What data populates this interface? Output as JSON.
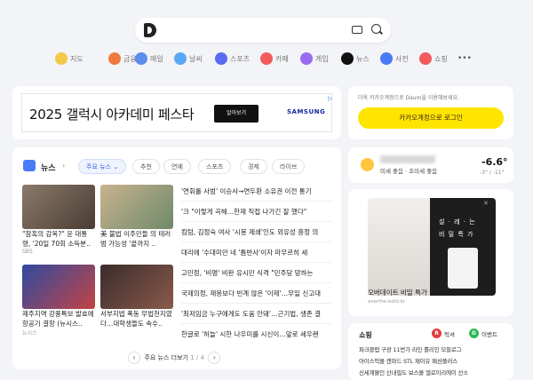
{
  "search": {
    "logo": "D"
  },
  "services": [
    {
      "label": "지도",
      "color": "#f3c948"
    },
    {
      "label": "금융",
      "color": "#f07a3e"
    },
    {
      "label": "메일",
      "color": "#5b8def"
    },
    {
      "label": "날씨",
      "color": "#5aa7f2"
    },
    {
      "label": "스포츠",
      "color": "#5a6cf0"
    },
    {
      "label": "카페",
      "color": "#f25c5c"
    },
    {
      "label": "게임",
      "color": "#9a6bf2"
    },
    {
      "label": "쇼핑",
      "color": "#f25c5c"
    }
  ],
  "more_label": "•••",
  "ad_banner": {
    "text": "2025 갤럭시 아카데미 페스타",
    "button": "알아보기",
    "brand": "SAMSUNG",
    "ad_mark": "▷"
  },
  "news": {
    "title": "뉴스",
    "tabs": [
      "주요 뉴스",
      "추천",
      "연예",
      "스포츠",
      "경제",
      "라이브"
    ],
    "cards": [
      {
        "caption": "\"참혹의 감옥?\" 윤 대통령, '20일 70회 소득분..",
        "source": "SBS",
        "color": "#7a6657"
      },
      {
        "caption": "美 불법 이주민들 의 테러범 가능성 '끝까지 ..",
        "source": "",
        "color": "#b39a78"
      },
      {
        "caption": "제주지역 강풍특보 발효에 항공기 결항 (뉴시스..",
        "source": "뉴시스",
        "color": "#2d3d7a"
      },
      {
        "caption": "서부지법 폭동 무법천지였다…대학생들도 속수..",
        "source": "",
        "color": "#5a4040"
      }
    ],
    "headlines": [
      "'연휘롤 사범' 이승사→연두환 소유권 이전 통기",
      "'크 \"이렇게 곡해…한재 직접 나가긴 잘 했다\"",
      "킴텀, 김정숙 여사 '시봉 제쇄'인도 외유성 흥정 의",
      "대리에 '수대미만 네 '틈반사'이자 마무르히 세",
      "고민정, '비명' 비판 유시민 식격 \"민주당 망하는",
      "국제의정, 재몽보다 빈계 않은 '이제'…무일 신고대",
      "'최저임금 누구에게도 도움 안돼'…근기법, 생존 결",
      "한글로 '허늘' 시한 나우미를 시신이…앞로 세우랜"
    ],
    "pager_label": "주요 뉴스 더보기",
    "pager_page": "1 / 4"
  },
  "login": {
    "notice": "더욱 카카오계정으로 Daum을 이용해보세요.",
    "button": "카카오계정으로 로그인"
  },
  "weather": {
    "sub": "미세 좋음 · 초미세 좋음",
    "temp": "-6.6°",
    "range": "-3° / -11°"
  },
  "ad_box": {
    "line1": "설 · 레 · 는",
    "line2": "비 밀 특 가",
    "caption": "오버데이트 비밀 특가",
    "url": "overthe.bold.kr",
    "close": "✕"
  },
  "shopping": {
    "title": "쇼핑",
    "badge1": "럭셔",
    "badge2": "이벤트",
    "row1": "파크클럽  구광  11번가  라인  롤리인  모들로그",
    "row2": "아이스픽몰  캔마드  STL  제이유  패션플러스",
    "row3": "신세계몰인  산내필도  보스몰  엘로이리에이  산소"
  }
}
